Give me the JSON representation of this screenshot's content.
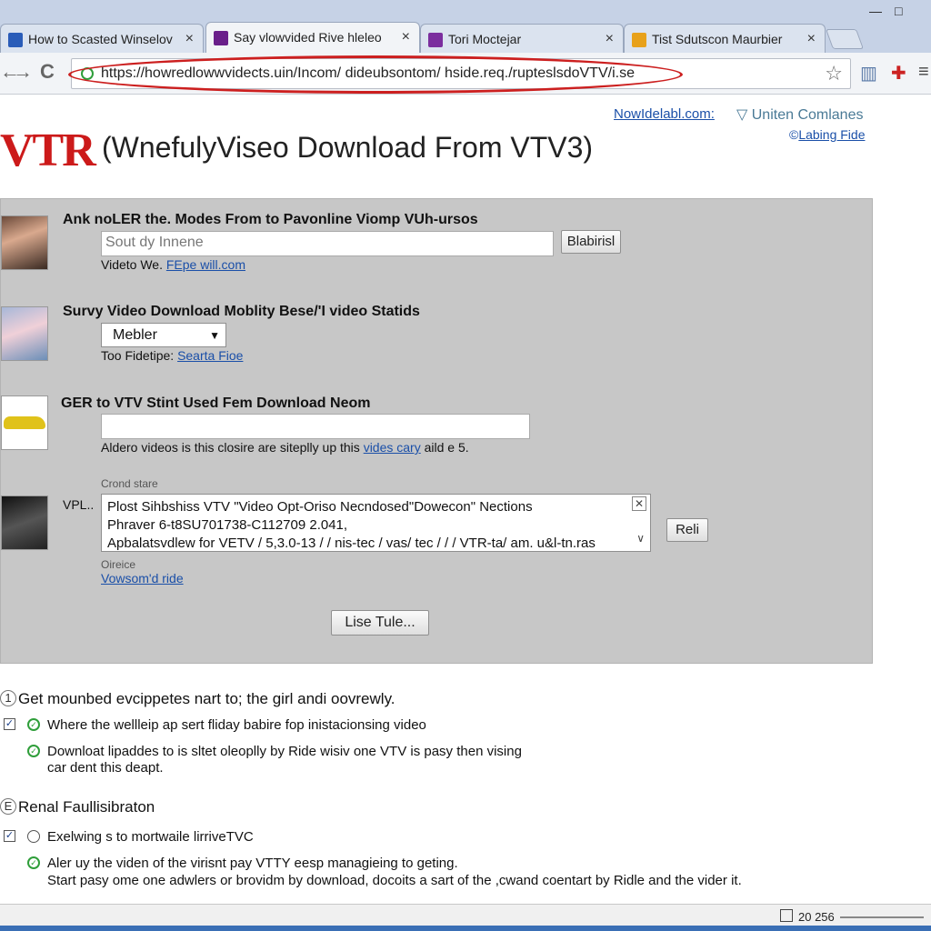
{
  "tabs": [
    {
      "label": "How to Scasted Winselov",
      "close": "×"
    },
    {
      "label": "Say vlowvided Rive hleleo",
      "close": "×"
    },
    {
      "label": "Tori Moctejar",
      "close": "×"
    },
    {
      "label": "Tist Sdutscon Maurbier",
      "close": "×"
    }
  ],
  "window_controls": {
    "minimize": "—",
    "maximize": "□"
  },
  "toolbar": {
    "back": "←",
    "forward": "→",
    "reload": "C",
    "url": "https://howredlowwvidects.uin/Incom/ dideubsontom/ hside.req./rupteslsdoVTV/i.se",
    "star": "☆"
  },
  "header": {
    "logo": "VTR",
    "title": "(WnefulyViseo Download From VTV3)",
    "link1": "NowIdelabl.com:",
    "link2": "Uniten Comlanes",
    "link3": "Labing Fide"
  },
  "panel": {
    "section1": {
      "heading": "Ank noLER the. Modes From to Pavonline Viomp VUh-ursos",
      "placeholder": "Sout dy Innene",
      "button": "Blabirisl",
      "hint_prefix": "Videto We. ",
      "hint_link": "FEpe will.com"
    },
    "section2": {
      "heading": "Survy Video Download Moblity Bese/'I video Statids",
      "select_value": "Mebler",
      "hint_prefix": "Too Fidetipe: ",
      "hint_link": "Searta Fioe"
    },
    "section3": {
      "heading": "GER to VTV Stint Used Fem Download Neom",
      "hint_prefix": "Aldero videos is this closire are siteplly up this ",
      "hint_link": "vides cary",
      "hint_suffix": " aild e 5."
    },
    "section4": {
      "caption": "Crond stare",
      "label": "VPL..",
      "lines": [
        "Plost Sihbshiss VTV \"Video Opt-Oriso Necndosed\"Dowecon\" Nections",
        "Phraver 6-t8SU701738-C112709 2.041,",
        "Apbalatsvdlew for VETV / 5,3.0-13 / / nis-tec / vas/ tec / / / VTR-ta/ am. u&l-tn.ras"
      ],
      "button": "Reli",
      "sub_caption": "Oireice",
      "sub_link": "Vowsom'd ride"
    },
    "action_button": "Lise Tule..."
  },
  "list": {
    "group1": {
      "number": "1",
      "heading": "Get mounbed evcippetes nart to; the girl andi oovrewly.",
      "items": [
        "Where the wellleip ap sert fliday babire fop inistacionsing video",
        "Downloat lipaddes to is sltet oleoplly by Ride wisiv one VTV is pasy then vising",
        "car dent this deapt."
      ]
    },
    "group2": {
      "number": "E",
      "heading": "Renal Faullisibraton",
      "items": [
        "Exelwing s to mortwaile lirriveTVC",
        "Aler uy the viden of the virisnt pay VTTY eesp managieing to geting.",
        "Start pasy ome one adwlers or brovidm by download, docoits a sart of the ,cwand coentart by Ridle and the vider it."
      ]
    }
  },
  "status": {
    "count": "20 256"
  },
  "colors": {
    "accent_red": "#cc1a1a",
    "link_blue": "#1a4fa8",
    "panel_grey": "#c7c7c7",
    "ok_green": "#2f9e3a"
  }
}
